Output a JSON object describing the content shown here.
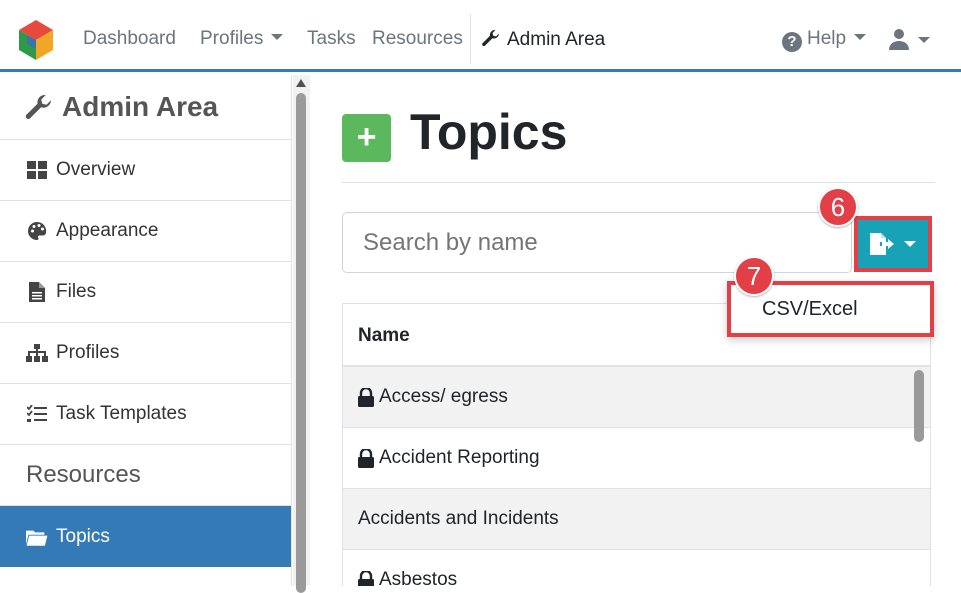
{
  "nav": {
    "dashboard": "Dashboard",
    "profiles": "Profiles",
    "tasks": "Tasks",
    "resources": "Resources",
    "admin_area": "Admin Area",
    "help": "Help"
  },
  "sidebar": {
    "title": "Admin Area",
    "items": [
      {
        "label": "Overview",
        "icon": "grid-icon"
      },
      {
        "label": "Appearance",
        "icon": "palette-icon"
      },
      {
        "label": "Files",
        "icon": "file-icon"
      },
      {
        "label": "Profiles",
        "icon": "sitemap-icon"
      },
      {
        "label": "Task Templates",
        "icon": "tasks-icon"
      }
    ],
    "section": "Resources",
    "active_item": {
      "label": "Topics",
      "icon": "folder-icon"
    }
  },
  "main": {
    "title": "Topics",
    "add_label": "+",
    "search_placeholder": "Search by name",
    "export_menu": [
      "CSV/Excel"
    ],
    "badges": [
      "6",
      "7"
    ],
    "table": {
      "header": "Name",
      "rows": [
        {
          "name": "Access/ egress",
          "locked": true
        },
        {
          "name": "Accident Reporting",
          "locked": true
        },
        {
          "name": "Accidents and Incidents",
          "locked": false
        },
        {
          "name": "Asbestos",
          "locked": true
        }
      ]
    }
  },
  "colors": {
    "primary": "#337ab7",
    "success": "#5cb85c",
    "info": "#17a2b8",
    "annotation": "#e33f47"
  }
}
